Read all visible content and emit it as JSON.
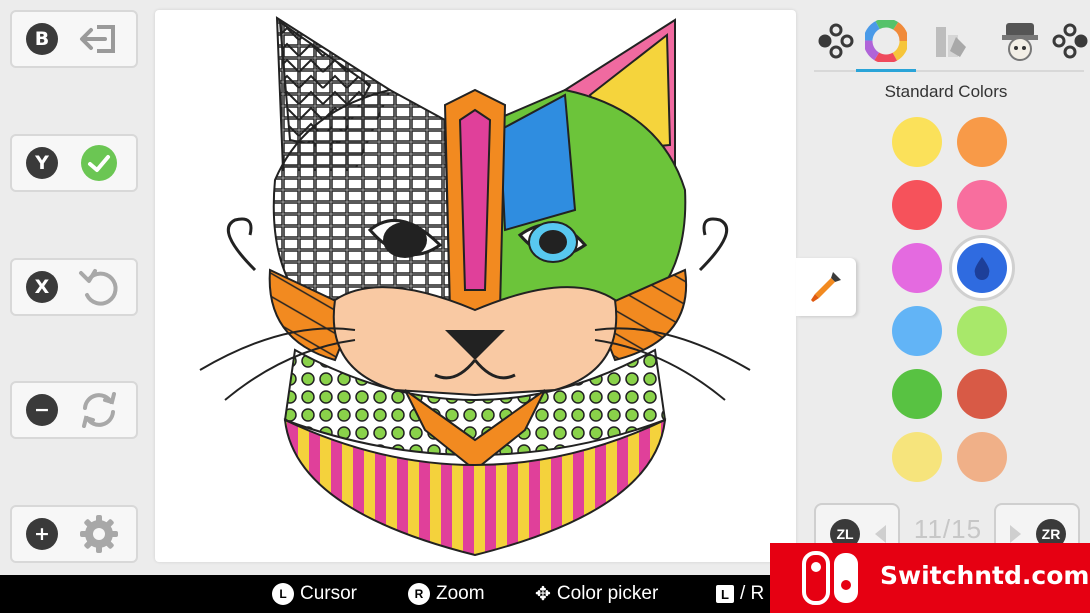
{
  "left_controls": [
    {
      "button": "B",
      "action_icon": "exit-icon"
    },
    {
      "button": "Y",
      "action_icon": "confirm-check-icon"
    },
    {
      "button": "X",
      "action_icon": "undo-icon"
    },
    {
      "button": "−",
      "action_icon": "reset-icon"
    },
    {
      "button": "+",
      "action_icon": "settings-gear-icon"
    }
  ],
  "panel": {
    "tabs": [
      "palette-nav-left-icon",
      "color-wheel-icon",
      "gradient-icon",
      "character-icon",
      "palette-nav-right-icon"
    ],
    "active_tab": "color-wheel-icon",
    "title": "Standard Colors",
    "swatches": [
      "#fbe15a",
      "#f89a48",
      "#f6525b",
      "#f86e9e",
      "#e46ae0",
      "#2f6be0",
      "#62b4f6",
      "#a8e86a",
      "#58c242",
      "#d85a46",
      "#f6e47c",
      "#f0b088"
    ],
    "selected_swatch_index": 5,
    "pager": {
      "left_button": "ZL",
      "right_button": "ZR",
      "indicator": "11/15"
    }
  },
  "hints": [
    {
      "glyph": "L",
      "label": "Cursor"
    },
    {
      "glyph": "R",
      "label": "Zoom"
    },
    {
      "glyph": "✥",
      "label": "Color picker"
    },
    {
      "glyph": "L",
      "label": "/ R"
    }
  ],
  "watermark": {
    "text": "Switchntd.com"
  },
  "accent_color": "#2aa4d8"
}
